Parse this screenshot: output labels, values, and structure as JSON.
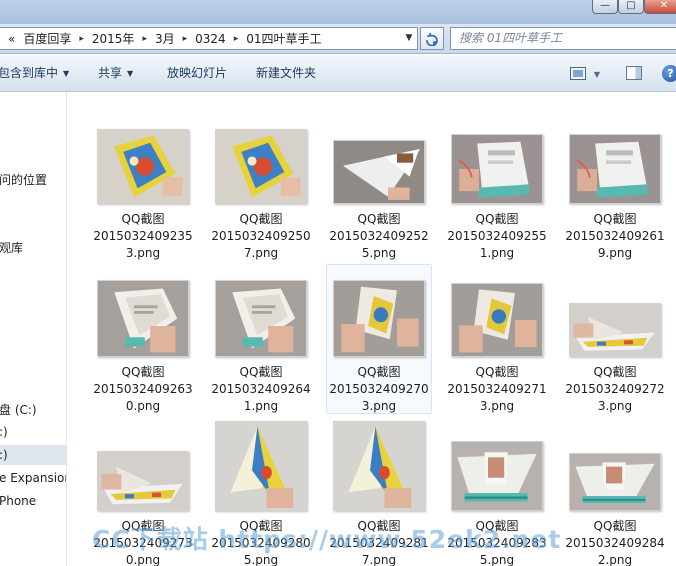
{
  "window_controls": {
    "minimize": "—",
    "maximize": "□",
    "close": "✕"
  },
  "address": {
    "back_chevron": "«",
    "crumbs": [
      "百度回享",
      "2015年",
      "3月",
      "0324",
      "01四叶草手工"
    ],
    "separator": "▸",
    "dropdown": "▼",
    "refresh_icon": "refresh-icon"
  },
  "search": {
    "placeholder": "搜索 01四叶草手工"
  },
  "commands": {
    "include_library": "包含到库中",
    "share": "共享",
    "slideshow": "放映幻灯片",
    "new_folder": "新建文件夹",
    "dropdown_arrow": "▼",
    "help": "?"
  },
  "nav": {
    "items": [
      "问的位置",
      "观库",
      "盘 (C:)",
      ":)",
      ":)",
      "e Expansion",
      "Phone"
    ]
  },
  "files": [
    {
      "l1": "QQ截图",
      "l2": "2015032409235",
      "l3": "3.png",
      "scene": "card_flat"
    },
    {
      "l1": "QQ截图",
      "l2": "2015032409250",
      "l3": "7.png",
      "scene": "card_flat"
    },
    {
      "l1": "QQ截图",
      "l2": "2015032409252",
      "l3": "5.png",
      "scene": "triangle_white"
    },
    {
      "l1": "QQ截图",
      "l2": "2015032409255",
      "l3": "1.png",
      "scene": "fold_white"
    },
    {
      "l1": "QQ截图",
      "l2": "2015032409261",
      "l3": "9.png",
      "scene": "fold_white"
    },
    {
      "l1": "QQ截图",
      "l2": "2015032409263",
      "l3": "0.png",
      "scene": "fold_hand"
    },
    {
      "l1": "QQ截图",
      "l2": "2015032409264",
      "l3": "1.png",
      "scene": "fold_hand"
    },
    {
      "l1": "QQ截图",
      "l2": "2015032409270",
      "l3": "3.png",
      "scene": "fold_color"
    },
    {
      "l1": "QQ截图",
      "l2": "2015032409271",
      "l3": "3.png",
      "scene": "fold_color"
    },
    {
      "l1": "QQ截图",
      "l2": "2015032409272",
      "l3": "3.png",
      "scene": "boat"
    },
    {
      "l1": "QQ截图",
      "l2": "2015032409273",
      "l3": "0.png",
      "scene": "boat"
    },
    {
      "l1": "QQ截图",
      "l2": "2015032409280",
      "l3": "5.png",
      "scene": "pyramid"
    },
    {
      "l1": "QQ截图",
      "l2": "2015032409281",
      "l3": "7.png",
      "scene": "pyramid"
    },
    {
      "l1": "QQ截图",
      "l2": "2015032409283",
      "l3": "5.png",
      "scene": "boat_white"
    },
    {
      "l1": "QQ截图",
      "l2": "2015032409284",
      "l3": "2.png",
      "scene": "boat_white"
    }
  ],
  "watermark": "CC下载站 https://www.52ek2.net",
  "colors": {
    "accent": "#2a67b3",
    "hover_border": "#d6e6f6",
    "selected_nav": "#dfe6ee"
  }
}
